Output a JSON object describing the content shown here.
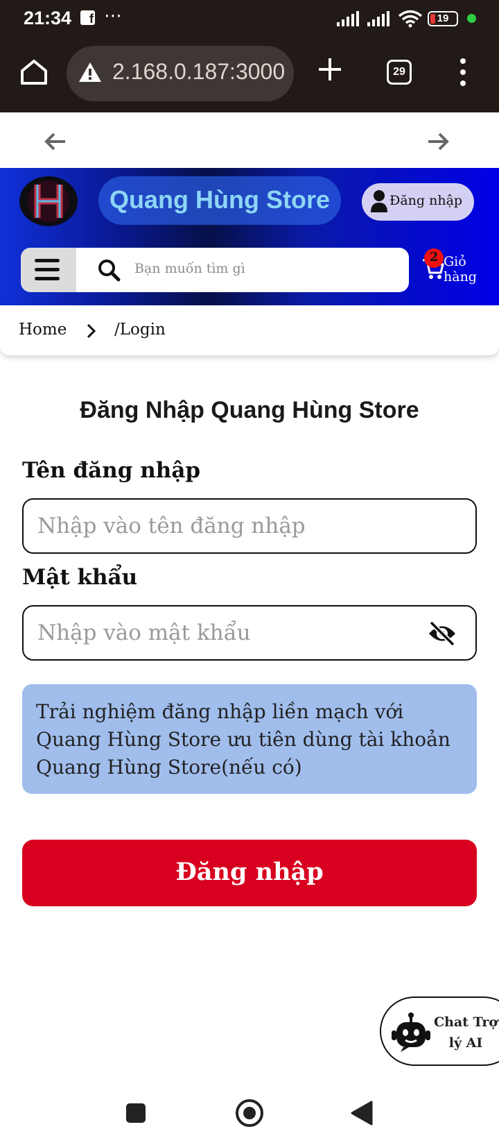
{
  "status_bar": {
    "time": "21:34",
    "notification_icon": "facebook-icon",
    "more": "⋯",
    "battery": "19",
    "battery_color": "#e53935",
    "indicator_color": "#2ecc40"
  },
  "browser": {
    "url": "2.168.0.187:3000",
    "tab_count": "29"
  },
  "header": {
    "store_name": "Quang Hùng Store",
    "login_label": "Đăng nhập",
    "search_placeholder": "Bạn muốn tìm gì",
    "cart_count": "2",
    "cart_label": "Giỏ hàng",
    "gradient": [
      "#1030d8",
      "#061048",
      "#0000e6"
    ]
  },
  "breadcrumb": {
    "home": "Home",
    "current": "/Login"
  },
  "form": {
    "title": "Đăng Nhập Quang Hùng Store",
    "username_label": "Tên đăng nhập",
    "username_placeholder": "Nhập vào tên đăng nhập",
    "password_label": "Mật khẩu",
    "password_placeholder": "Nhập vào mật khẩu",
    "info_text": "Trải nghiệm đăng nhập liền mạch với Quang Hùng Store ưu tiên dùng tài khoản Quang Hùng Store(nếu có)",
    "submit_label": "Đăng nhập",
    "submit_color": "#d8001f",
    "info_color": "#a0bdec"
  },
  "chat": {
    "label": "Chat Trợ lý AI"
  }
}
